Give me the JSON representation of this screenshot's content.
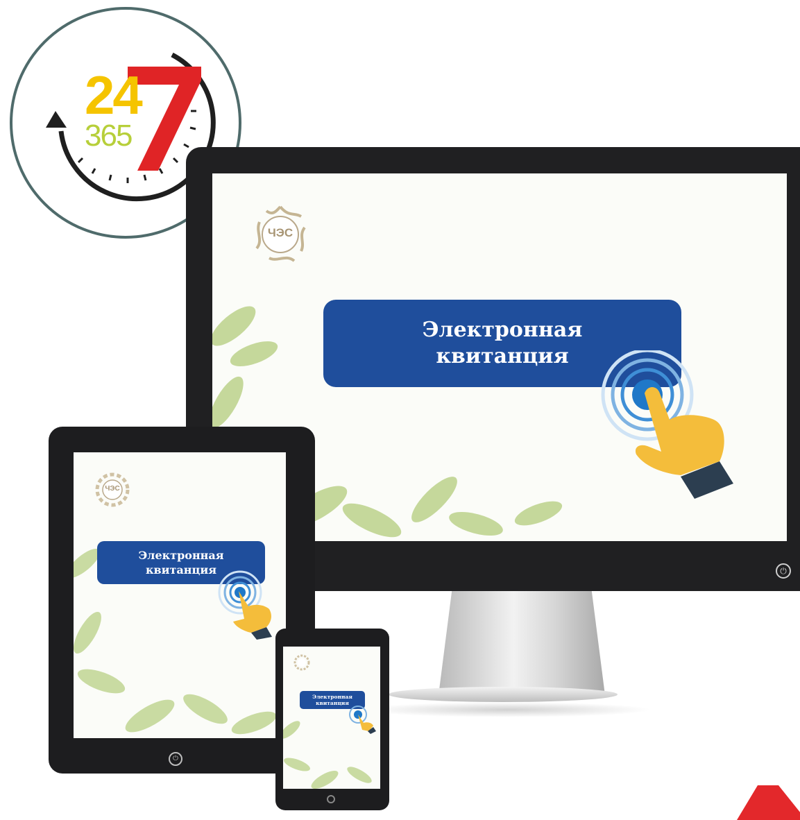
{
  "badge": {
    "number_24": "24",
    "number_7": "7",
    "number_365": "365",
    "colors": {
      "ring": "#4f6b6b",
      "yellow": "#f5c400",
      "red": "#e02426",
      "green": "#b7cf3a",
      "arrow": "#1f1f1f"
    }
  },
  "logo": {
    "text": "ЧЭС",
    "color": "#b9a88a"
  },
  "monitor": {
    "button_line1": "Электронная",
    "button_line2": "квитанция",
    "power_glyph": "⏻"
  },
  "tablet": {
    "button_line1": "Электронная",
    "button_line2": "квитанция",
    "power_glyph": "⏻"
  },
  "phone": {
    "button_line1": "Электронная",
    "button_line2": "квитанция"
  },
  "colors": {
    "button": "#1f4e9c",
    "hand": "#f4bd3b",
    "cuff": "#2c3e50",
    "ripple": "#1f78c8",
    "leaf": "#9dbd5c"
  },
  "icons": [
    "clock-arrow-icon",
    "sun-logo-icon",
    "pointing-hand-icon",
    "power-icon"
  ]
}
